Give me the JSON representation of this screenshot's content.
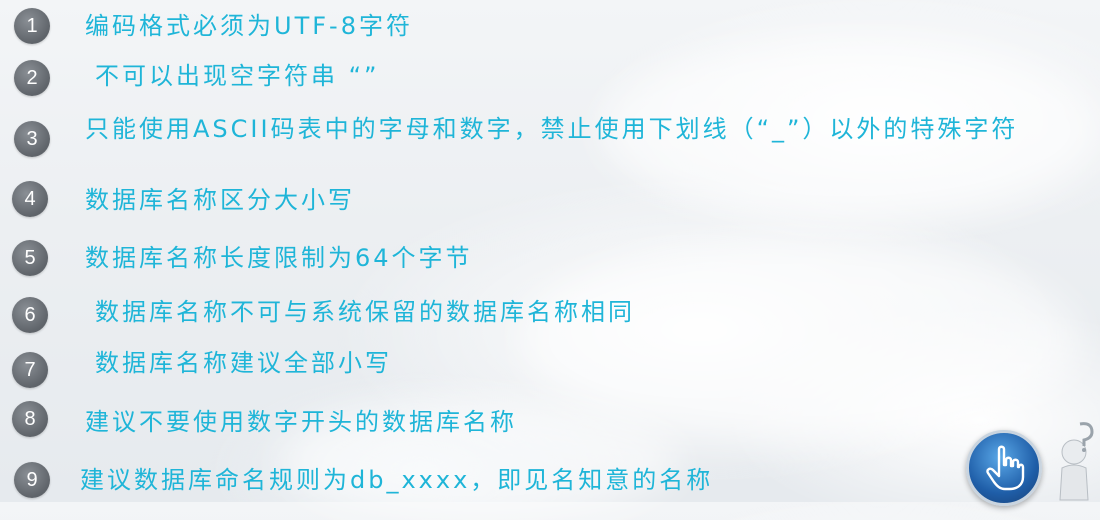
{
  "rules": [
    {
      "num": "1",
      "text": "编码格式必须为UTF-8字符"
    },
    {
      "num": "2",
      "text": "不可以出现空字符串  “”"
    },
    {
      "num": "3",
      "text": "只能使用ASCII码表中的字母和数字，禁止使用下划线（“_”）以外的特殊字符"
    },
    {
      "num": "4",
      "text": "数据库名称区分大小写"
    },
    {
      "num": "5",
      "text": "数据库名称长度限制为64个字节"
    },
    {
      "num": "6",
      "text": "数据库名称不可与系统保留的数据库名称相同"
    },
    {
      "num": "7",
      "text": "数据库名称建议全部小写"
    },
    {
      "num": "8",
      "text": "建议不要使用数字开头的数据库名称"
    },
    {
      "num": "9",
      "text": "建议数据库命名规则为db_xxxx，即见名知意的名称"
    }
  ],
  "colors": {
    "text": "#1fb5d8",
    "badge": "#6b7076"
  },
  "icons": [
    "hand-pointer-icon",
    "person-question-icon"
  ]
}
